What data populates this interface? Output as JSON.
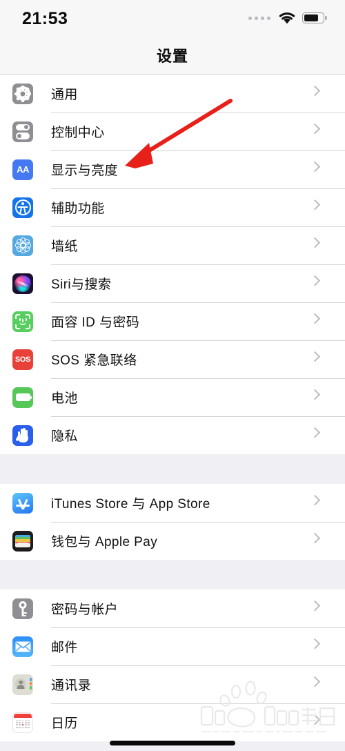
{
  "statusbar": {
    "time": "21:53",
    "signal_icon": "signal-dots-icon",
    "wifi_icon": "wifi-icon",
    "battery_icon": "battery-icon",
    "battery_level": 75
  },
  "navbar": {
    "title": "设置"
  },
  "colors": {
    "page_background": "#efeff4",
    "row_background": "#ffffff",
    "separator": "#d3d3d6",
    "chevron": "#bcbcc0",
    "label_text": "#111111",
    "annotation_arrow": "#e8201a"
  },
  "groups": [
    {
      "rows": [
        {
          "label": "通用",
          "icon": "gear-icon",
          "icon_class": "ic-general",
          "chevron": true
        },
        {
          "label": "控制中心",
          "icon": "sliders-icon",
          "icon_class": "ic-control",
          "chevron": true
        },
        {
          "label": "显示与亮度",
          "icon": "aa-text-icon",
          "icon_class": "ic-display",
          "chevron": true
        },
        {
          "label": "辅助功能",
          "icon": "accessibility-icon",
          "icon_class": "ic-access",
          "chevron": true
        },
        {
          "label": "墙纸",
          "icon": "wallpaper-flower-icon",
          "icon_class": "ic-wall",
          "chevron": true
        },
        {
          "label": "Siri与搜索",
          "icon": "siri-orb-icon",
          "icon_class": "ic-siri",
          "chevron": true
        },
        {
          "label": "面容 ID 与密码",
          "icon": "face-id-icon",
          "icon_class": "ic-faceid",
          "chevron": true
        },
        {
          "label": "SOS 紧急联络",
          "icon": "sos-icon",
          "icon_class": "ic-sos",
          "chevron": true
        },
        {
          "label": "电池",
          "icon": "battery-icon",
          "icon_class": "ic-batt",
          "chevron": true
        },
        {
          "label": "隐私",
          "icon": "hand-privacy-icon",
          "icon_class": "ic-privacy",
          "chevron": true
        }
      ]
    },
    {
      "rows": [
        {
          "label": "iTunes Store 与 App Store",
          "icon": "app-store-icon",
          "icon_class": "ic-store",
          "chevron": true
        },
        {
          "label": "钱包与 Apple Pay",
          "icon": "wallet-icon",
          "icon_class": "ic-wallet",
          "chevron": true
        }
      ]
    },
    {
      "rows": [
        {
          "label": "密码与帐户",
          "icon": "key-icon",
          "icon_class": "ic-pass",
          "chevron": true
        },
        {
          "label": "邮件",
          "icon": "mail-envelope-icon",
          "icon_class": "ic-mail",
          "chevron": true
        },
        {
          "label": "通讯录",
          "icon": "contacts-icon",
          "icon_class": "ic-contacts",
          "chevron": true
        },
        {
          "label": "日历",
          "icon": "calendar-icon",
          "icon_class": "ic-cal",
          "chevron": true
        }
      ]
    }
  ],
  "annotation": {
    "type": "red-arrow",
    "points_to": "显示与亮度",
    "color": "#e8201a"
  },
  "watermark": {
    "brand": "Baidu",
    "brand_cn": "经验",
    "url": "jingyan.baidu.com"
  },
  "home_indicator": "home-indicator"
}
